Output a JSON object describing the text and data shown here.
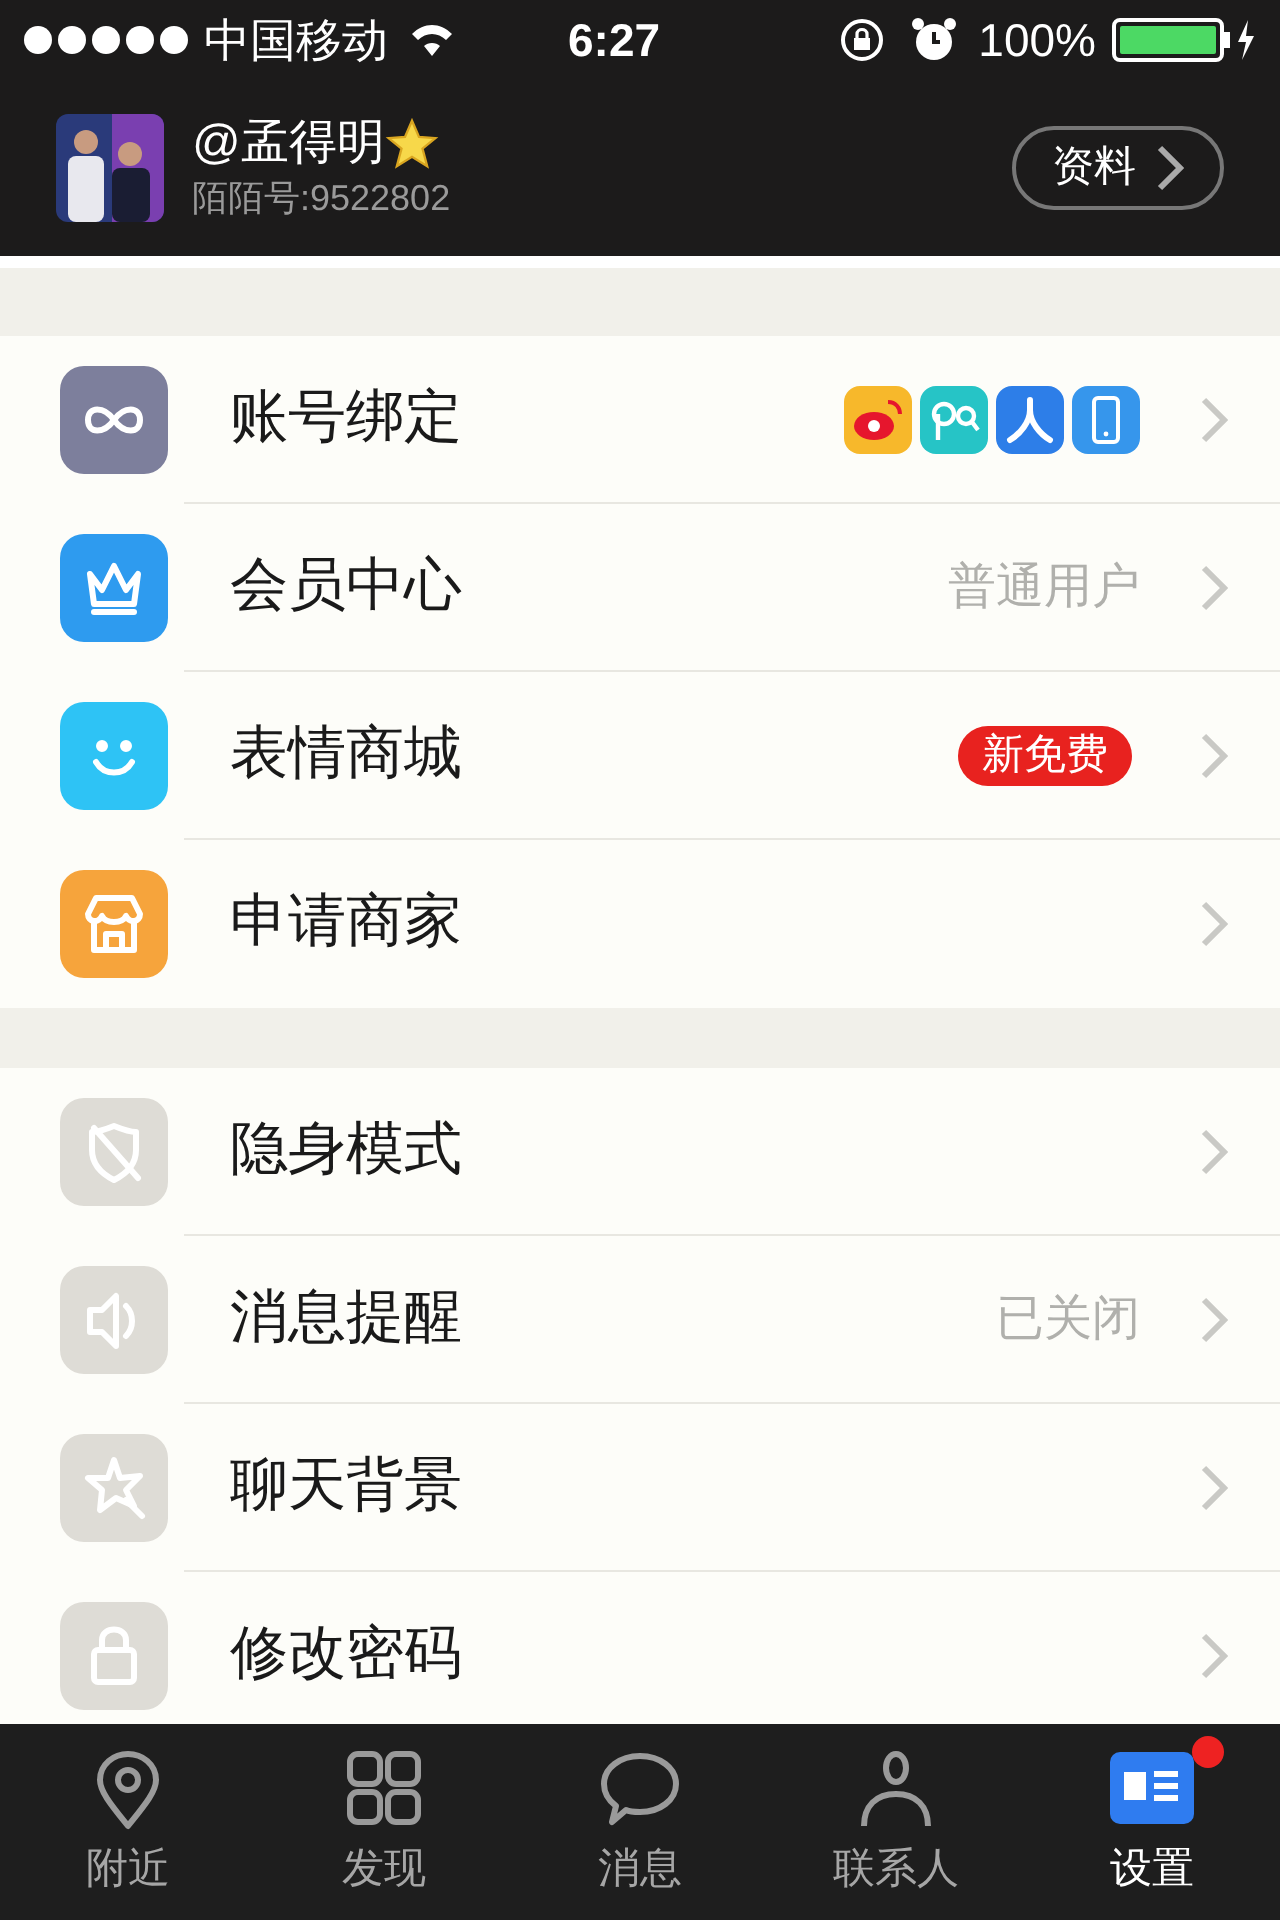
{
  "status_bar": {
    "carrier": "中国移动",
    "time": "6:27",
    "battery": "100%"
  },
  "profile": {
    "name": "@孟得明",
    "starred": true,
    "momo_id": "陌陌号:9522802",
    "button": "资料"
  },
  "sections": [
    {
      "rows": [
        {
          "kind": "link",
          "color": "#7d7f9c",
          "label": "账号绑定",
          "accounts": [
            {
              "kind": "weibo"
            },
            {
              "kind": "chat"
            },
            {
              "kind": "renren"
            },
            {
              "kind": "phone"
            }
          ]
        },
        {
          "kind": "crown",
          "color": "#2e9bef",
          "label": "会员中心",
          "value": "普通用户"
        },
        {
          "kind": "smile",
          "color": "#2ec3f5",
          "label": "表情商城",
          "badge": "新免费"
        },
        {
          "kind": "shop",
          "color": "#f6a43c",
          "label": "申请商家"
        }
      ]
    },
    {
      "rows": [
        {
          "kind": "shield",
          "color": "#dedcd6",
          "label": "隐身模式"
        },
        {
          "kind": "speaker",
          "color": "#dedcd6",
          "label": "消息提醒",
          "value": "已关闭"
        },
        {
          "kind": "star",
          "color": "#dedcd6",
          "label": "聊天背景"
        },
        {
          "kind": "lock",
          "color": "#dedcd6",
          "label": "修改密码"
        }
      ]
    }
  ],
  "tabs": [
    {
      "kind": "pin",
      "label": "附近",
      "selected": false,
      "dot": false
    },
    {
      "kind": "grid",
      "label": "发现",
      "selected": false,
      "dot": false
    },
    {
      "kind": "bubble",
      "label": "消息",
      "selected": false,
      "dot": false
    },
    {
      "kind": "person",
      "label": "联系人",
      "selected": false,
      "dot": false
    },
    {
      "kind": "card",
      "label": "设置",
      "selected": true,
      "dot": true
    }
  ]
}
